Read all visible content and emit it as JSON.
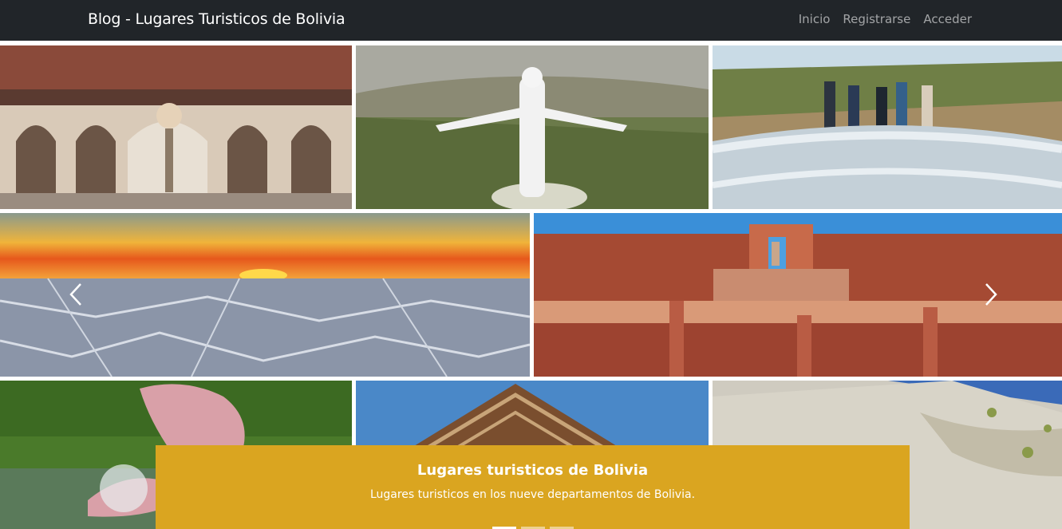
{
  "nav": {
    "brand": "Blog - Lugares Turisticos de Bolivia",
    "links": [
      "Inicio",
      "Registrarse",
      "Acceder"
    ]
  },
  "carousel": {
    "caption_title": "Lugares turisticos de Bolivia",
    "caption_text": "Lugares turisticos en los nueve departamentos de Bolivia.",
    "prev_icon": "chevron-left-icon",
    "next_icon": "chevron-right-icon",
    "indicator_count": 3,
    "active_indicator": 1,
    "caption_color": "#daa520"
  },
  "colors": {
    "navbar": "#212529",
    "nav_link": "rgba(255,255,255,0.55)",
    "brand": "#ffffff"
  }
}
